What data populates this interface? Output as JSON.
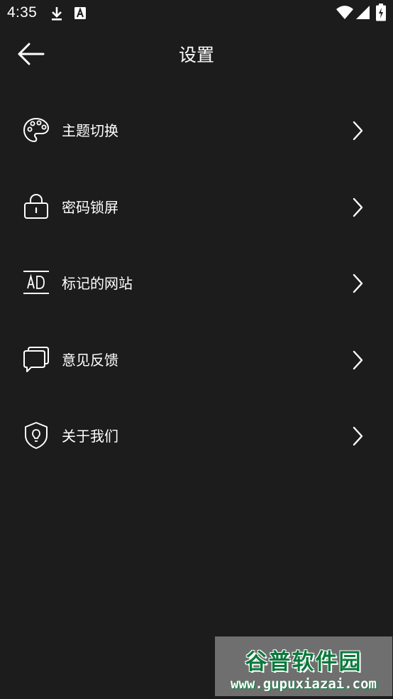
{
  "status_bar": {
    "time": "4:35",
    "icons": [
      "download-icon",
      "a-notification-icon",
      "wifi-icon",
      "signal-icon",
      "battery-charging-icon"
    ]
  },
  "app_bar": {
    "back_icon": "arrow-left-icon",
    "title": "设置"
  },
  "menu": {
    "items": [
      {
        "label": "主题切换",
        "icon": "palette-icon"
      },
      {
        "label": "密码锁屏",
        "icon": "lock-icon"
      },
      {
        "label": "标记的网站",
        "icon": "ad-icon"
      },
      {
        "label": "意见反馈",
        "icon": "feedback-icon"
      },
      {
        "label": "关于我们",
        "icon": "shield-info-icon"
      }
    ],
    "chevron_icon": "chevron-right-icon"
  },
  "watermark": {
    "title": "谷普软件园",
    "url": "www.gupuxiazai.com"
  },
  "colors": {
    "background": "#1c1c1c",
    "text": "#ffffff",
    "watermark_green": "#0b7a3c"
  }
}
